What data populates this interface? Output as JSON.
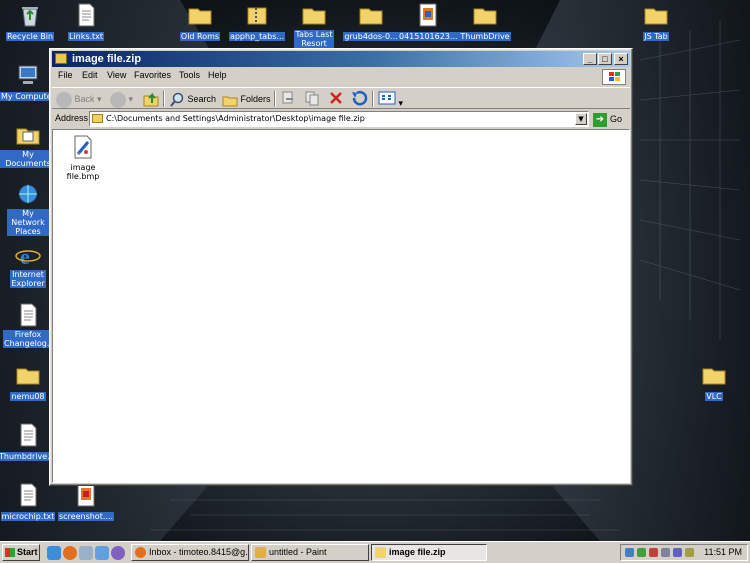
{
  "desktop": {
    "icons": [
      {
        "label": "Recycle Bin",
        "icon": "recycle-bin-icon"
      },
      {
        "label": "Links.txt",
        "icon": "text-file-icon"
      },
      {
        "label": "Old Roms",
        "icon": "folder-icon"
      },
      {
        "label": "apphp_tabs...",
        "icon": "zip-file-icon"
      },
      {
        "label": "Tabs Last Resort",
        "icon": "folder-icon"
      },
      {
        "label": "grub4dos-0...",
        "icon": "folder-icon"
      },
      {
        "label": "0415101623...",
        "icon": "image-file-icon"
      },
      {
        "label": "ThumbDrive",
        "icon": "folder-icon"
      },
      {
        "label": "JS Tab",
        "icon": "folder-icon"
      },
      {
        "label": "My Computer",
        "icon": "my-computer-icon"
      },
      {
        "label": "My Documents",
        "icon": "my-documents-icon"
      },
      {
        "label": "My Network Places",
        "icon": "network-places-icon"
      },
      {
        "label": "Internet Explorer",
        "icon": "internet-explorer-icon"
      },
      {
        "label": "Firefox Changelog.txt",
        "icon": "text-file-icon"
      },
      {
        "label": "nemu08",
        "icon": "folder-icon"
      },
      {
        "label": "Thumbdrive.txt",
        "icon": "text-file-icon"
      },
      {
        "label": "microchip.txt",
        "icon": "text-file-icon"
      },
      {
        "label": "screenshot....",
        "icon": "image-file-icon"
      },
      {
        "label": "VLC",
        "icon": "folder-icon"
      }
    ]
  },
  "window": {
    "title": "image file.zip",
    "minimize": "_",
    "maximize": "□",
    "close": "×",
    "menus": [
      "File",
      "Edit",
      "View",
      "Favorites",
      "Tools",
      "Help"
    ],
    "toolbar": {
      "back": "Back",
      "search": "Search",
      "folders": "Folders"
    },
    "address_label": "Address",
    "address_value": "C:\\Documents and Settings\\Administrator\\Desktop\\image file.zip",
    "go_label": "Go",
    "files": [
      {
        "name": "image file.bmp",
        "icon": "bitmap-file-icon"
      }
    ]
  },
  "taskbar": {
    "start_label": "Start",
    "tasks": [
      {
        "label": "Inbox - timoteo.8415@g...",
        "icon": "firefox-icon",
        "active": false
      },
      {
        "label": "untitled - Paint",
        "icon": "paint-icon",
        "active": false
      },
      {
        "label": "image file.zip",
        "icon": "folder-icon",
        "active": true
      }
    ],
    "clock": "11:51 PM"
  },
  "colors": {
    "titlebar_start": "#0a246a",
    "titlebar_end": "#a6caf0",
    "selection": "#316ac5",
    "window_face": "#d4d0c8"
  }
}
